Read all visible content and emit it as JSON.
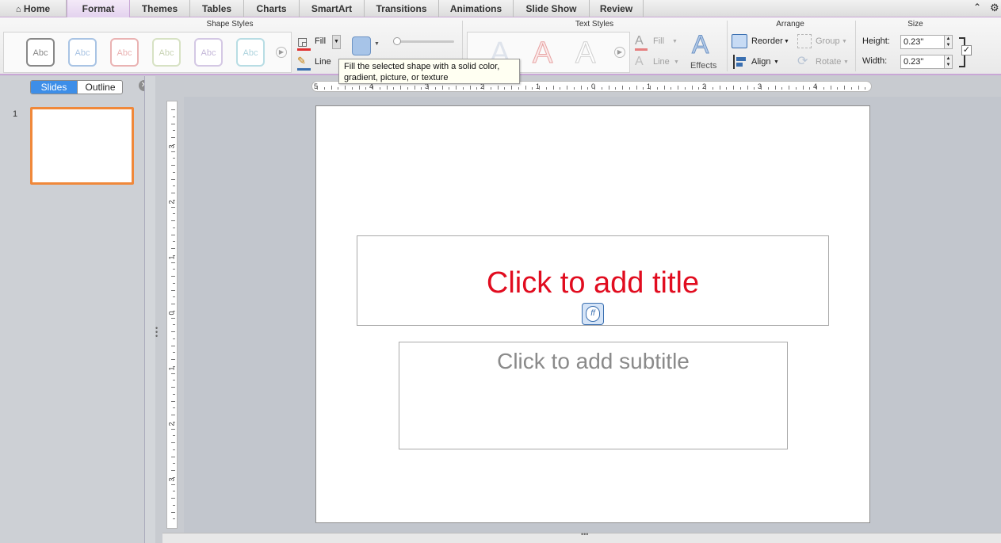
{
  "tabs": [
    {
      "label": "Home",
      "active": false
    },
    {
      "label": "Format",
      "active": true
    },
    {
      "label": "Themes",
      "active": false
    },
    {
      "label": "Tables",
      "active": false
    },
    {
      "label": "Charts",
      "active": false
    },
    {
      "label": "SmartArt",
      "active": false
    },
    {
      "label": "Transitions",
      "active": false
    },
    {
      "label": "Animations",
      "active": false
    },
    {
      "label": "Slide Show",
      "active": false
    },
    {
      "label": "Review",
      "active": false
    }
  ],
  "ribbon": {
    "groups": {
      "shape_styles": "Shape Styles",
      "text_styles": "Text Styles",
      "arrange": "Arrange",
      "size": "Size"
    },
    "style_samples": [
      "Abc",
      "Abc",
      "Abc",
      "Abc",
      "Abc",
      "Abc"
    ],
    "fill_label": "Fill",
    "line_label": "Line",
    "text_fill_label": "Fill",
    "text_line_label": "Line",
    "effects_label": "Effects",
    "reorder_label": "Reorder",
    "align_label": "Align",
    "group_label": "Group",
    "rotate_label": "Rotate",
    "height_label": "Height:",
    "height_value": "0.23\"",
    "width_label": "Width:",
    "width_value": "0.23\""
  },
  "tooltip": "Fill the selected shape with a solid color, gradient, picture, or texture",
  "left_pane": {
    "slides_tab": "Slides",
    "outline_tab": "Outline",
    "slide_number": "1"
  },
  "hruler_labels": [
    "5",
    "4",
    "3",
    "2",
    "1",
    "0",
    "1",
    "2",
    "3",
    "4"
  ],
  "vruler_labels": [
    "3",
    "2",
    "1",
    "0",
    "1",
    "2",
    "3"
  ],
  "slide": {
    "title_placeholder": "Click to add title",
    "subtitle_placeholder": "Click to add subtitle"
  },
  "colors": {
    "accent": "#c9a7d6",
    "title_color": "#e10c1f",
    "subtitle_color": "#8a8a8a",
    "selected_thumb": "#f0883a",
    "segment_active": "#3d8ee8"
  }
}
